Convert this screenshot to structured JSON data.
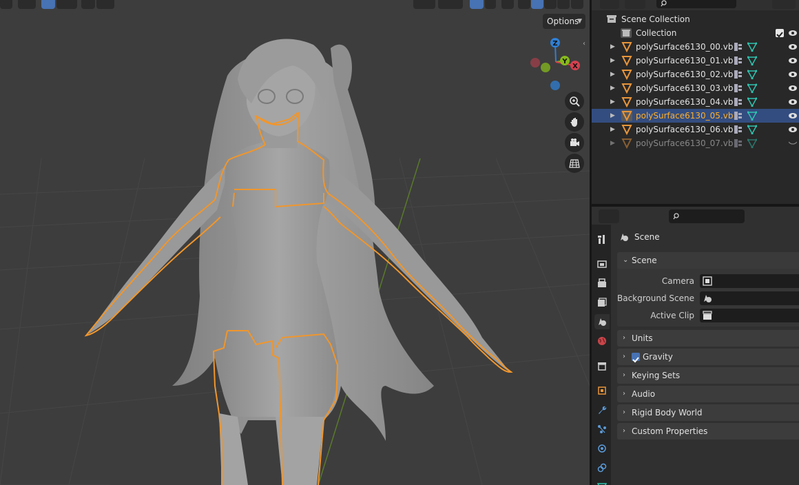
{
  "viewport": {
    "options_label": "Options",
    "gizmo": {
      "z": "Z",
      "y": "Y",
      "x": "X"
    },
    "nav_icons": [
      "zoom-icon",
      "hand-pan-icon",
      "camera-view-icon",
      "grid-ortho-icon"
    ]
  },
  "outliner": {
    "rows": [
      {
        "label": "Scene Collection"
      },
      {
        "label": "Collection"
      },
      {
        "label": "polySurface6130_00.vb"
      },
      {
        "label": "polySurface6130_01.vb"
      },
      {
        "label": "polySurface6130_02.vb"
      },
      {
        "label": "polySurface6130_03.vb"
      },
      {
        "label": "polySurface6130_04.vb"
      },
      {
        "label": "polySurface6130_05.vb"
      },
      {
        "label": "polySurface6130_06.vb"
      },
      {
        "label": "polySurface6130_07.vb"
      }
    ],
    "selected_row": "polySurface6130_05.vb"
  },
  "properties": {
    "context": "Scene",
    "panels": {
      "scene": {
        "title": "Scene",
        "camera_label": "Camera",
        "background_label": "Background Scene",
        "clip_label": "Active Clip"
      },
      "units": "Units",
      "gravity": "Gravity",
      "keying_sets": "Keying Sets",
      "audio": "Audio",
      "rigid_body": "Rigid Body World",
      "custom_props": "Custom Properties"
    }
  },
  "colors": {
    "selection_outline": "#f0962c",
    "accent_blue": "#4772b3",
    "selected_row": "#334d80",
    "axis_x": "#d4404f",
    "axis_y": "#86b91c",
    "axis_z": "#2f7fd4"
  }
}
